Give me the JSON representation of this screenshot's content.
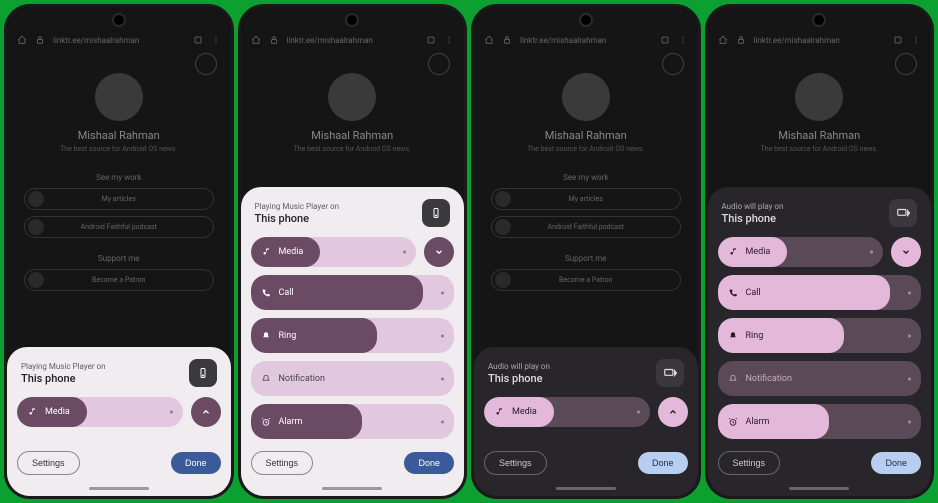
{
  "background": {
    "url": "linktr.ee/mishaalrahman",
    "profile_name": "Mishaal Rahman",
    "profile_sub": "The best source for Android OS news.",
    "section_work": "See my work",
    "btn_articles": "My articles",
    "btn_podcast": "Android Faithful podcast",
    "section_support": "Support me",
    "btn_patron": "Become a Patron"
  },
  "p1": {
    "header_sub": "Playing Music Player on",
    "header_main": "This phone",
    "media": "Media",
    "media_pct": 42,
    "settings": "Settings",
    "done": "Done"
  },
  "p2": {
    "header_sub": "Playing Music Player on",
    "header_main": "This phone",
    "media": "Media",
    "media_pct": 42,
    "call": "Call",
    "call_pct": 85,
    "ring": "Ring",
    "ring_pct": 62,
    "notification": "Notification",
    "notif_pct": 0,
    "alarm": "Alarm",
    "alarm_pct": 55,
    "settings": "Settings",
    "done": "Done"
  },
  "p3": {
    "header_sub": "Audio will play on",
    "header_main": "This phone",
    "media": "Media",
    "media_pct": 42,
    "settings": "Settings",
    "done": "Done"
  },
  "p4": {
    "header_sub": "Audio will play on",
    "header_main": "This phone",
    "media": "Media",
    "media_pct": 42,
    "call": "Call",
    "call_pct": 85,
    "ring": "Ring",
    "ring_pct": 62,
    "notification": "Notification",
    "notif_pct": 0,
    "alarm": "Alarm",
    "alarm_pct": 55,
    "settings": "Settings",
    "done": "Done"
  }
}
